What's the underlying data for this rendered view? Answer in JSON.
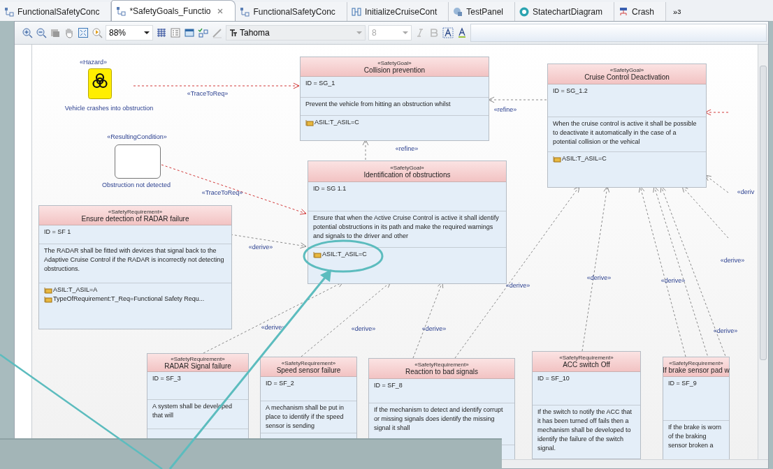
{
  "tabs": [
    {
      "label": "FunctionalSafetyConc",
      "kind": "diagram",
      "selected": false
    },
    {
      "label": "*SafetyGoals_Functio",
      "kind": "diagram",
      "selected": true
    },
    {
      "label": "FunctionalSafetyConc",
      "kind": "diagram",
      "selected": false
    },
    {
      "label": "InitializeCruiseCont",
      "kind": "activity",
      "selected": false
    },
    {
      "label": "TestPanel",
      "kind": "panel",
      "selected": false
    },
    {
      "label": "StatechartDiagram",
      "kind": "statechart",
      "selected": false
    },
    {
      "label": "Crash",
      "kind": "fta",
      "selected": false
    }
  ],
  "tab_overflow": {
    "label": "»",
    "count": "3"
  },
  "toolbar": {
    "zoom": "88%",
    "font": "Tahoma",
    "font_size": "8",
    "font_size_disabled": true
  },
  "diagram": {
    "hazard": {
      "stereotype": "«Hazard»",
      "name": "Vehicle crashes into obstruction"
    },
    "condition": {
      "stereotype": "«ResultingCondition»",
      "name": "Obstruction not detected"
    },
    "blocks": [
      {
        "stereotype": "«SafetyGoal»",
        "name": "Collision prevention",
        "id": "ID = SG_1",
        "description": "Prevent the vehicle from hitting an obstruction whilst",
        "properties": [
          "ASIL:T_ASIL=C"
        ]
      },
      {
        "stereotype": "«SafetyGoal»",
        "name": "Cruise Control Deactivation",
        "id": "ID = SG_1.2",
        "description": "When the cruise control is active it shall be possible to deactivate it automatically in the case of a potential collision or the vehical",
        "properties": [
          "ASIL:T_ASIL=C"
        ]
      },
      {
        "stereotype": "«SafetyGoal»",
        "name": "Identification of obstructions",
        "id": "ID = SG 1.1",
        "description": "Ensure that when the Active Cruise Control is active it shall identify potential obstructions in its path and make the required warnings and signals to the driver and other",
        "properties": [
          "ASIL:T_ASIL=C"
        ]
      },
      {
        "stereotype": "«SafetyRequirement»",
        "name": "Ensure detection of RADAR failure",
        "id": "ID = SF 1",
        "description": "The RADAR shall be fitted with devices that signal back to the Adaptive Cruise Control if the RADAR is incorrectly not detecting obstructions.",
        "properties": [
          "ASIL:T_ASIL=A",
          "TypeOfRequirement:T_Req=Functional Safety Requ..."
        ]
      },
      {
        "stereotype": "«SafetyRequirement»",
        "name": "RADAR Signal failure",
        "id": "ID = SF_3",
        "description": "A system shall be developed that will"
      },
      {
        "stereotype": "«SafetyRequirement»",
        "name": "Speed sensor failure",
        "id": "ID = SF_2",
        "description": "A mechanism shall be put in place to identify if the speed sensor is sending"
      },
      {
        "stereotype": "«SafetyRequirement»",
        "name": "Reaction to bad signals",
        "id": "ID = SF_8",
        "description": "If the mechanism to detect and identify corrupt or missing signals does identify the missing signal it shall"
      },
      {
        "stereotype": "«SafetyRequirement»",
        "name": "ACC switch Off",
        "id": "ID = SF_10",
        "description": "If the switch to notify the ACC that it has been turned off fails then a mechanism shall be developed to identify the failure of the switch signal."
      },
      {
        "stereotype": "«SafetyRequirement»",
        "name": "If brake sensor pad w",
        "id": "ID = SF_9",
        "description": "If the brake is worn of the braking sensor broken a"
      }
    ],
    "connector_labels": [
      "«TraceToReq»",
      "«TraceToReq»",
      "«refine»",
      "«refine»",
      "«derive»",
      "«derive»",
      "«derive»",
      "«derive»",
      "«derive»",
      "«derive»",
      "«derive»",
      "«derive»",
      "«derive»",
      "«deriv"
    ]
  }
}
